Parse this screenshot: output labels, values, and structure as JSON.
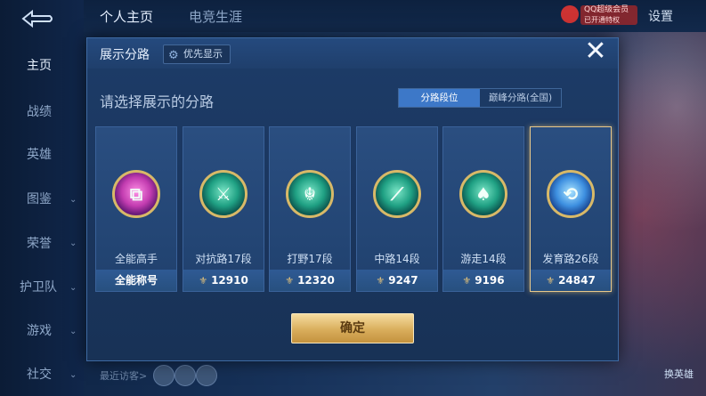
{
  "nav": {
    "items": [
      {
        "label": "主页",
        "active": true
      },
      {
        "label": "战绩"
      },
      {
        "label": "英雄"
      },
      {
        "label": "图鉴",
        "chevron": true
      },
      {
        "label": "荣誉",
        "chevron": true
      },
      {
        "label": "护卫队",
        "chevron": true
      },
      {
        "label": "游戏",
        "chevron": true
      },
      {
        "label": "社交",
        "chevron": true
      }
    ]
  },
  "top": {
    "tabs": [
      "个人主页",
      "电竞生涯"
    ],
    "settings": "设置",
    "badge_line1": "QQ超级会员",
    "badge_line2": "已开通特权"
  },
  "bottom": {
    "visitors_label": "最近访客>",
    "switch_hero": "换英雄"
  },
  "modal": {
    "title": "展示分路",
    "priority_label": "优先显示",
    "subtitle": "请选择展示的分路",
    "segments": [
      "分路段位",
      "巅峰分路(全国)"
    ],
    "confirm_label": "确定",
    "cards": [
      {
        "lane": "全能高手",
        "score_text": "全能称号",
        "emblem": "all-round-emblem",
        "glyph": "⧉",
        "color": "#c23cb0",
        "has_coin": false
      },
      {
        "lane": "对抗路17段",
        "score_text": "12910",
        "emblem": "clash-lane-emblem",
        "glyph": "⚔",
        "color": "#1fa083",
        "has_coin": true
      },
      {
        "lane": "打野17段",
        "score_text": "12320",
        "emblem": "jungle-emblem",
        "glyph": "☬",
        "color": "#1fa083",
        "has_coin": true
      },
      {
        "lane": "中路14段",
        "score_text": "9247",
        "emblem": "mid-lane-emblem",
        "glyph": "⟋",
        "color": "#1fa083",
        "has_coin": true
      },
      {
        "lane": "游走14段",
        "score_text": "9196",
        "emblem": "roam-emblem",
        "glyph": "♠",
        "color": "#1fa083",
        "has_coin": true
      },
      {
        "lane": "发育路26段",
        "score_text": "24847",
        "emblem": "farm-lane-emblem",
        "glyph": "⟲",
        "color": "#3d8fe0",
        "has_coin": true,
        "selected": true
      }
    ]
  }
}
